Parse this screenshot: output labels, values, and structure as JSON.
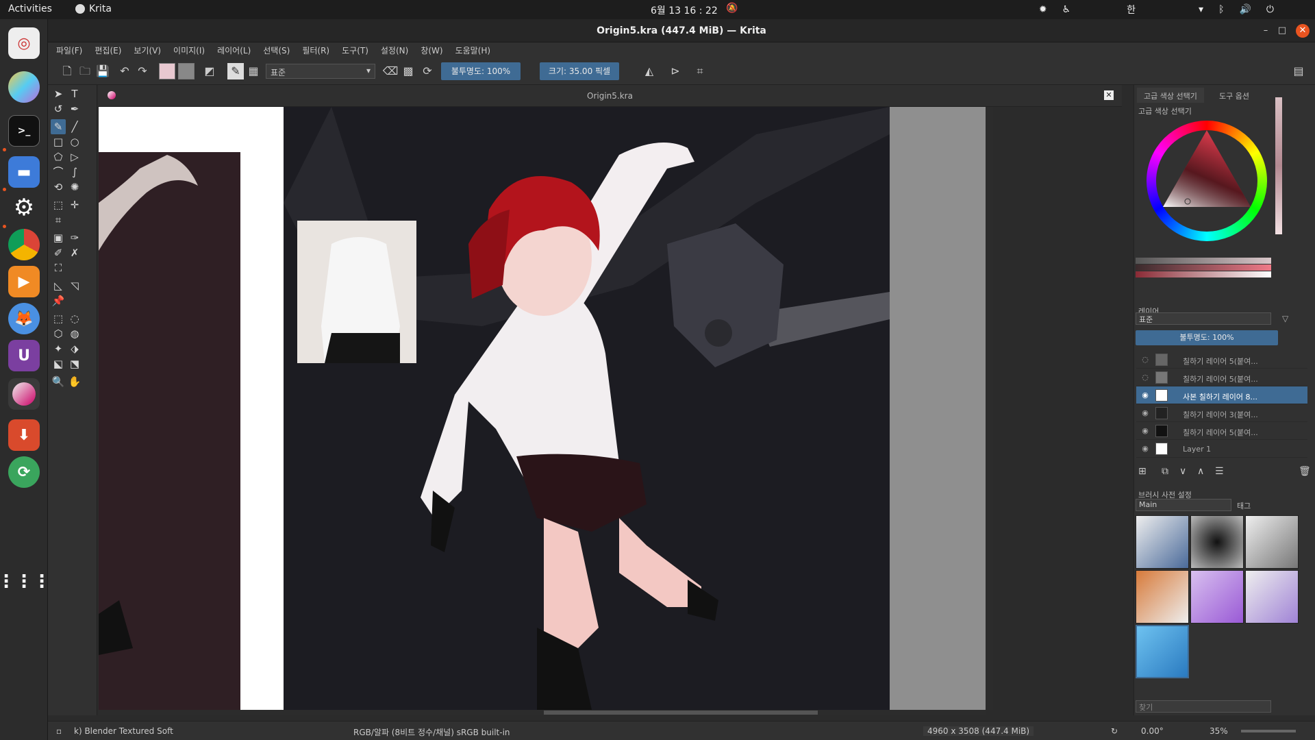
{
  "topbar": {
    "activities": "Activities",
    "app": "Krita",
    "clock": "6월 13  16 : 22",
    "input_method": "한"
  },
  "window": {
    "title": "Origin5.kra (447.4 MiB)  — Krita"
  },
  "menu": [
    "파일(F)",
    "편집(E)",
    "보기(V)",
    "이미지(I)",
    "레이어(L)",
    "선택(S)",
    "필터(R)",
    "도구(T)",
    "설정(N)",
    "창(W)",
    "도움말(H)"
  ],
  "toolbar": {
    "blend_mode": "표준",
    "opacity": "불투명도: 100%",
    "size": "크기: 35.00 픽셀"
  },
  "document": {
    "tab_title": "Origin5.kra"
  },
  "dockers": {
    "tab_color": "고급 색상 선택기",
    "tab_tool_options": "도구 옵션",
    "color_title": "고급 색상 선택기",
    "layers_title": "레이어",
    "layer_blend": "표준",
    "layer_opacity": "불투명도: 100%",
    "layers": [
      {
        "name": "칠하기 레이어 5(붙여...",
        "visible": false,
        "selected": false
      },
      {
        "name": "칠하기 레이어 5(붙여...",
        "visible": false,
        "selected": false
      },
      {
        "name": "사본 칠하기 레이어 8...",
        "visible": true,
        "selected": true
      },
      {
        "name": "칠하기 레이어 3(붙여...",
        "visible": true,
        "selected": false
      },
      {
        "name": "칠하기 레이어 5(붙여...",
        "visible": true,
        "selected": false
      },
      {
        "name": "Layer 1",
        "visible": true,
        "selected": false
      }
    ],
    "brush_title": "브러시 사전 설정",
    "brush_tag": "Main",
    "brush_tag_label": "태그",
    "search_placeholder": "찾기"
  },
  "status": {
    "brush": "k) Blender Textured Soft",
    "color_space": "RGB/알파 (8비트 정수/채널)  sRGB built-in",
    "dimensions": "4960 x 3508 (447.4 MiB)",
    "rotation": "0.00°",
    "zoom": "35%"
  },
  "colors": {
    "accent": "#3f6b94",
    "brand": "#e95420"
  }
}
